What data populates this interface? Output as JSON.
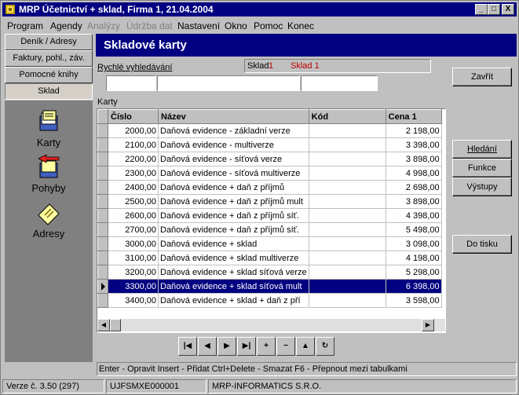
{
  "window": {
    "title": "MRP Účetnictví + sklad, Firma 1, 21.04.2004",
    "min_label": "_",
    "max_label": "□",
    "close_label": "X"
  },
  "menu": {
    "items": [
      "Program",
      "Agendy",
      "Analýzy",
      "Údržba dat",
      "Nastavení",
      "Okno",
      "Pomoc",
      "Konec"
    ],
    "disabled": [
      "Analýzy",
      "Údržba dat"
    ]
  },
  "sidebar": {
    "tabs": [
      "Deník / Adresy",
      "Faktury, pohl., záv.",
      "Pomocné knihy",
      "Sklad"
    ],
    "active_tab": "Sklad",
    "items": [
      {
        "label": "Karty",
        "icon": "cards-icon"
      },
      {
        "label": "Pohyby",
        "icon": "movements-icon"
      },
      {
        "label": "Adresy",
        "icon": "addresses-icon"
      }
    ]
  },
  "header": {
    "title": "Skladové karty"
  },
  "search": {
    "label": "Rychlé vyhledávání",
    "field1": "",
    "field2": "",
    "field3": ""
  },
  "warehouse": {
    "label": "Sklad",
    "code": "1",
    "name": "Sklad 1"
  },
  "grid": {
    "label": "Karty",
    "columns": [
      "Číslo",
      "Název",
      "Kód",
      "Cena 1"
    ],
    "rows": [
      {
        "cislo": "2000,00",
        "nazev": "Daňová evidence - základní verze",
        "kod": "",
        "cena": "2 198,00"
      },
      {
        "cislo": "2100,00",
        "nazev": "Daňová evidence - multiverze",
        "kod": "",
        "cena": "3 398,00"
      },
      {
        "cislo": "2200,00",
        "nazev": "Daňová evidence - síťová verze",
        "kod": "",
        "cena": "3 898,00"
      },
      {
        "cislo": "2300,00",
        "nazev": "Daňová evidence - síťová multiverze",
        "kod": "",
        "cena": "4 998,00"
      },
      {
        "cislo": "2400,00",
        "nazev": "Daňová evidence + daň z příjmů",
        "kod": "",
        "cena": "2 698,00"
      },
      {
        "cislo": "2500,00",
        "nazev": "Daňová evidence + daň z příjmů mult",
        "kod": "",
        "cena": "3 898,00"
      },
      {
        "cislo": "2600,00",
        "nazev": "Daňová evidence + daň z příjmů síť.",
        "kod": "",
        "cena": "4 398,00"
      },
      {
        "cislo": "2700,00",
        "nazev": "Daňová evidence + daň z příjmů síť.",
        "kod": "",
        "cena": "5 498,00"
      },
      {
        "cislo": "3000,00",
        "nazev": "Daňová evidence + sklad",
        "kod": "",
        "cena": "3 098,00"
      },
      {
        "cislo": "3100,00",
        "nazev": "Daňová evidence + sklad multiverze",
        "kod": "",
        "cena": "4 198,00"
      },
      {
        "cislo": "3200,00",
        "nazev": "Daňová evidence + sklad síťová verze",
        "kod": "",
        "cena": "5 298,00"
      },
      {
        "cislo": "3300,00",
        "nazev": "Daňová evidence + sklad síťová mult",
        "kod": "",
        "cena": "6 398,00"
      },
      {
        "cislo": "3400,00",
        "nazev": "Daňová evidence + sklad + daň z pří",
        "kod": "",
        "cena": "3 598,00"
      }
    ],
    "selected_row": 11
  },
  "buttons": {
    "close": "Zavřít",
    "search": "Hledání",
    "functions": "Funkce",
    "outputs": "Výstupy",
    "print": "Do tisku"
  },
  "navigator": {
    "buttons": [
      {
        "name": "first-record-button",
        "glyph": "|◀"
      },
      {
        "name": "prior-record-button",
        "glyph": "◀"
      },
      {
        "name": "next-record-button",
        "glyph": "▶"
      },
      {
        "name": "last-record-button",
        "glyph": "▶|"
      },
      {
        "name": "insert-record-button",
        "glyph": "+"
      },
      {
        "name": "delete-record-button",
        "glyph": "−"
      },
      {
        "name": "edit-record-button",
        "glyph": "▲"
      },
      {
        "name": "refresh-record-button",
        "glyph": "↻"
      }
    ]
  },
  "hint": "Enter - Opravit   Insert - Přidat   Ctrl+Delete - Smazat   F6 - Přepnout mezi tabulkami",
  "status": {
    "version": "Verze č. 3.50 (297)",
    "license": "UJFSMXE000001",
    "company": "MRP-INFORMATICS S.R.O."
  },
  "colors": {
    "titlebar": "#000080",
    "selection": "#000080",
    "warehouse_value": "#c00000",
    "sidepanel": "#808080"
  }
}
